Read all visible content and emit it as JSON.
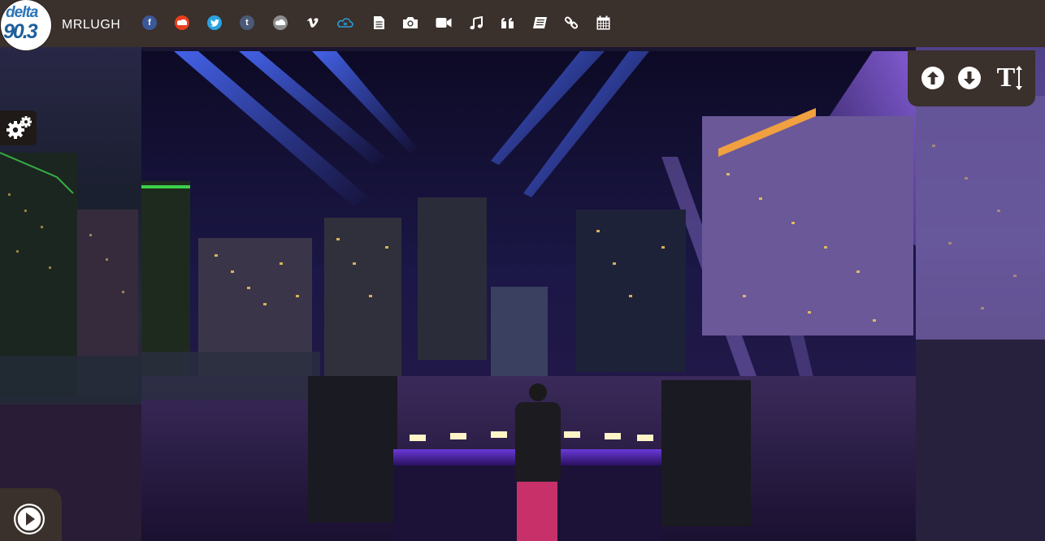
{
  "header": {
    "logo": {
      "line1": "delta",
      "line2": "90.3"
    },
    "username": "MRLUGH",
    "nav_icons": [
      {
        "name": "facebook-icon",
        "glyph": "f",
        "color": "#3b5998"
      },
      {
        "name": "soundcloud-icon",
        "glyph": "☁",
        "color": "#e8401c"
      },
      {
        "name": "twitter-icon",
        "glyph": "t",
        "color": "#2aa3e0"
      },
      {
        "name": "tumblr-icon",
        "glyph": "t",
        "color": "#4a5a78"
      },
      {
        "name": "cloud-icon",
        "glyph": "☁",
        "color": "#9a9a9a"
      },
      {
        "name": "vimeo-icon",
        "glyph": "v",
        "color": "#ffffff"
      },
      {
        "name": "mixcloud-icon",
        "glyph": "☁",
        "color": "#2a9ed8"
      },
      {
        "name": "document-icon"
      },
      {
        "name": "camera-icon"
      },
      {
        "name": "video-icon"
      },
      {
        "name": "music-icon"
      },
      {
        "name": "quote-icon"
      },
      {
        "name": "book-icon"
      },
      {
        "name": "link-icon"
      },
      {
        "name": "calendar-icon"
      }
    ]
  },
  "controls": {
    "scroll_up": "arrow-up-circle-icon",
    "scroll_down": "arrow-down-circle-icon",
    "text_size": "T"
  },
  "settings_icon": "gears-icon",
  "player": {
    "play_icon": "play-circle-icon"
  },
  "colors": {
    "bar": "#3a302c",
    "accent_blue": "#2a74b8"
  }
}
